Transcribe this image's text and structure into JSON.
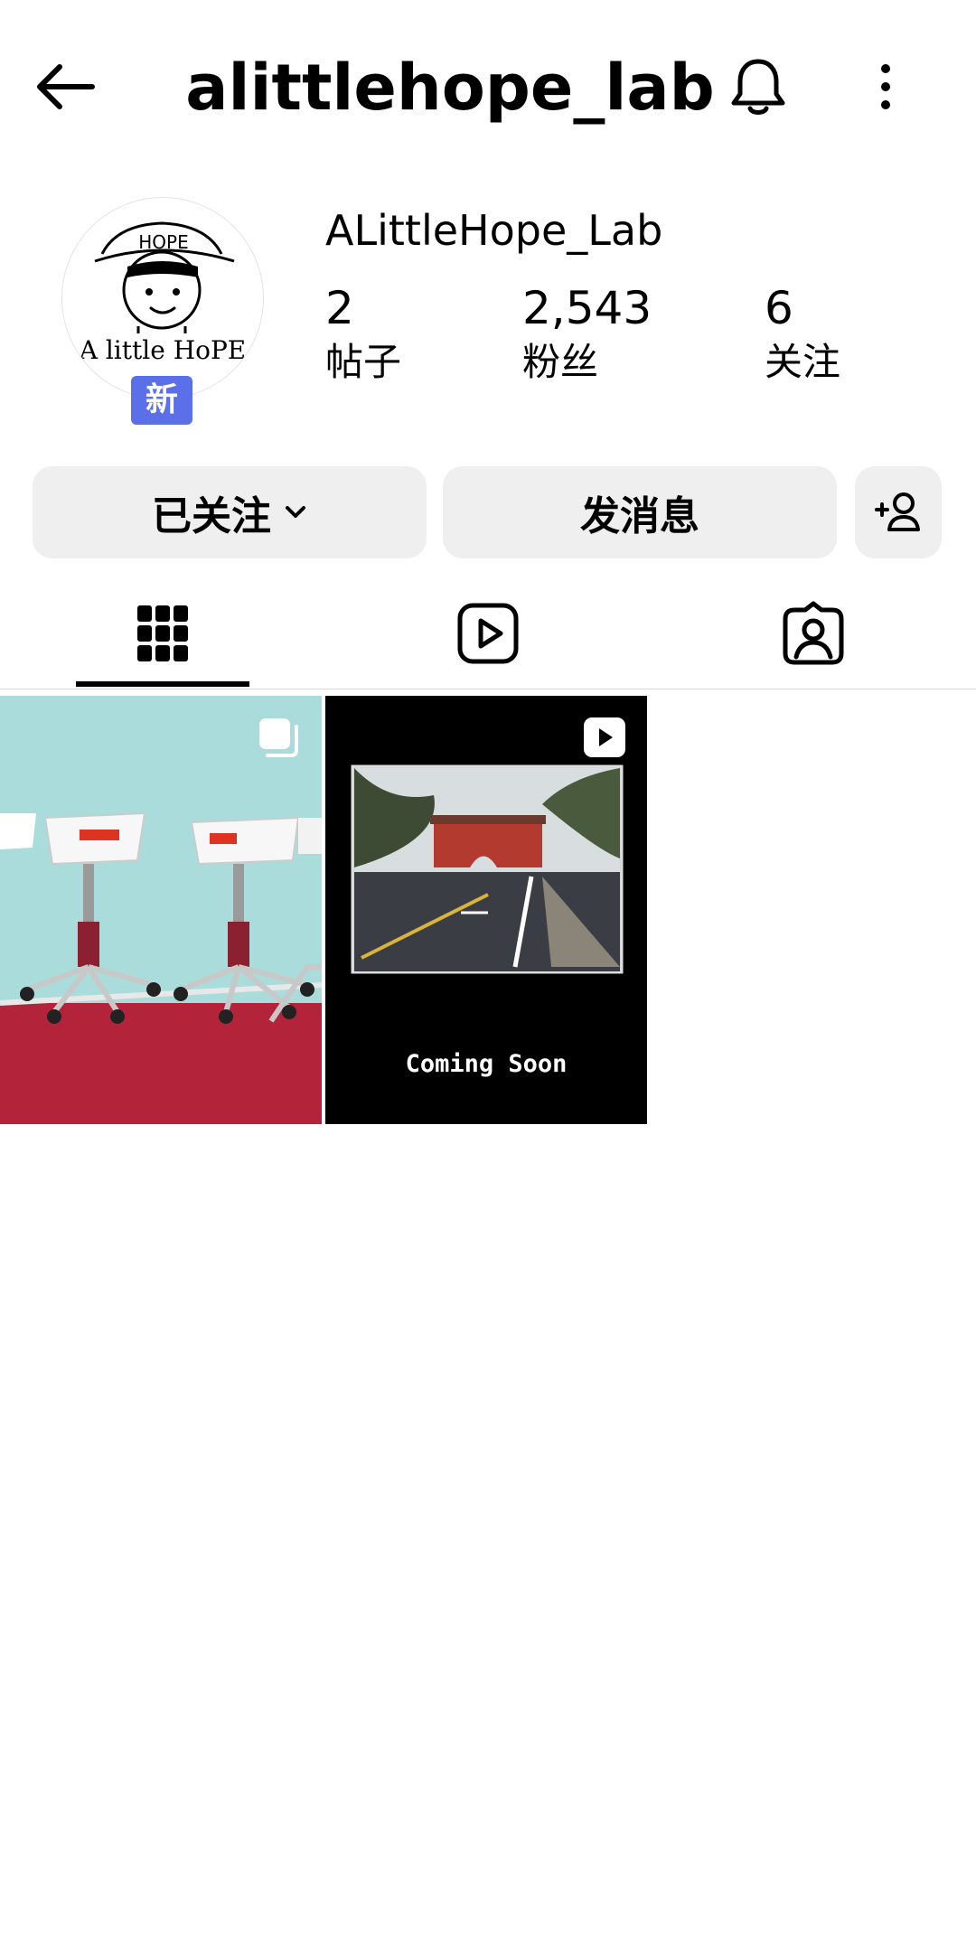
{
  "header": {
    "username": "alittlehope_lab",
    "back_icon": "arrow-left-icon",
    "bell_icon": "bell-icon",
    "more_icon": "more-vertical-icon"
  },
  "profile": {
    "display_name": "ALittleHope_Lab",
    "avatar_logo_text": "A little HoPE",
    "avatar_hat_text": "HOPE",
    "new_badge": "新",
    "stats": {
      "posts": {
        "value": "2",
        "label": "帖子"
      },
      "followers": {
        "value": "2,543",
        "label": "粉丝"
      },
      "following": {
        "value": "6",
        "label": "关注"
      }
    }
  },
  "actions": {
    "following_label": "已关注",
    "message_label": "发消息",
    "add_user_icon": "add-user-icon"
  },
  "tabs": [
    {
      "name": "grid",
      "icon": "grid-icon",
      "active": true
    },
    {
      "name": "reels",
      "icon": "reels-icon",
      "active": false
    },
    {
      "name": "tagged",
      "icon": "tagged-icon",
      "active": false
    }
  ],
  "posts": [
    {
      "type": "carousel",
      "overlay_icon": "carousel-icon"
    },
    {
      "type": "reel",
      "overlay_icon": "play-icon",
      "caption": "Coming Soon"
    }
  ],
  "colors": {
    "badge": "#5a6fe8",
    "button_bg": "#efefef"
  }
}
